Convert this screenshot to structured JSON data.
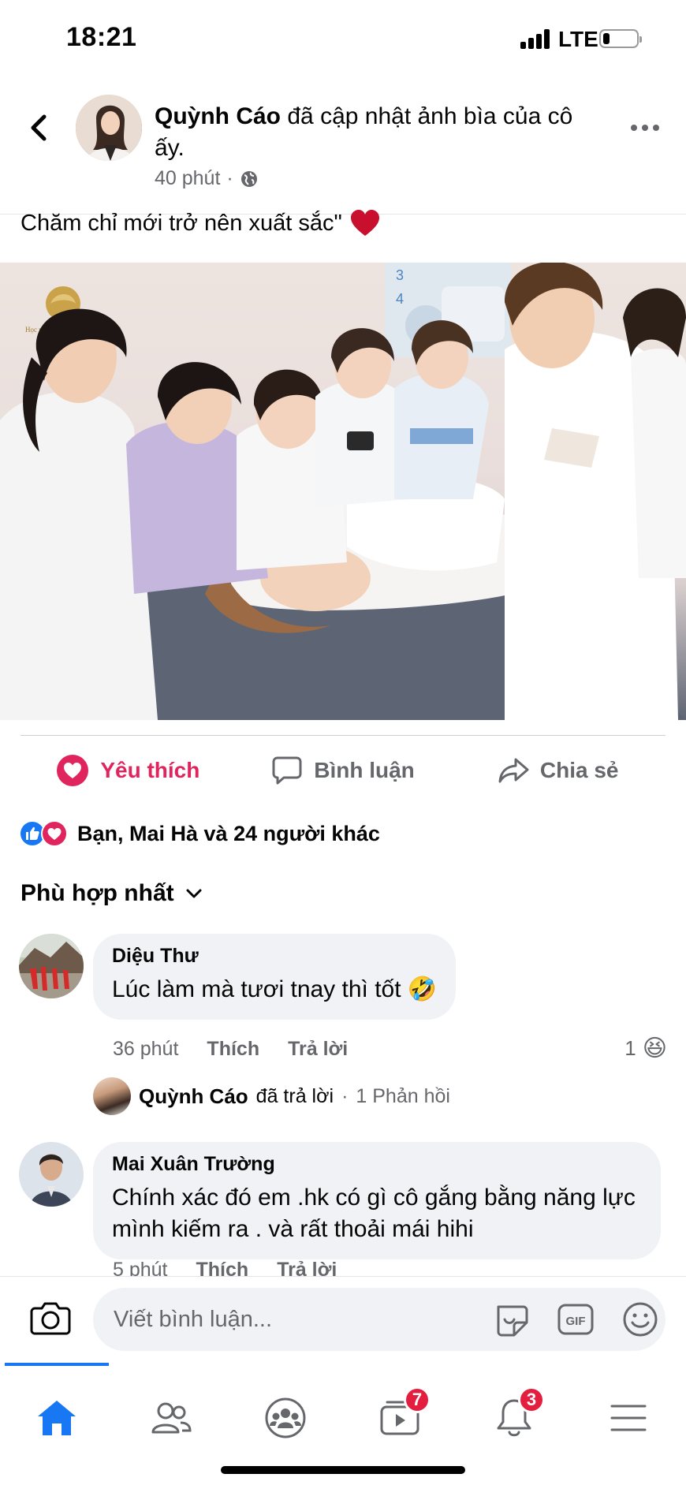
{
  "status_bar": {
    "time": "18:21",
    "network": "LTE",
    "battery_level": 0.2
  },
  "header": {
    "back_icon": "chevron-left-icon",
    "author": "Quỳnh Cáo",
    "action_text": "đã cập nhật ảnh bìa của cô ấy.",
    "time": "40 phút",
    "separator": "·",
    "privacy_icon": "globe-icon",
    "more_icon": "more-horizontal-icon"
  },
  "post": {
    "caption": "Chăm chỉ mới trở nên xuất sắc\"",
    "caption_emoji": "❤️",
    "photo_logo_text": "Học viện thẩm mỹ quốc tế MAYA"
  },
  "actions": {
    "like_label": "Yêu thích",
    "comment_label": "Bình luận",
    "share_label": "Chia sẻ"
  },
  "reactions": {
    "summary": "Bạn, Mai Hà và 24 người khác"
  },
  "sort": {
    "label": "Phù hợp nhất"
  },
  "comments": [
    {
      "name": "Diệu Thư",
      "text": "Lúc làm mà tươi tnay thì tốt 🤣",
      "time": "36 phút",
      "like_label": "Thích",
      "reply_label": "Trả lời",
      "reaction_count": "1",
      "reaction_emoji": "😆"
    },
    {
      "name": "Mai Xuân Trường",
      "text": "Chính xác đó em .hk có gì cô gắng bằng năng lực mình kiếm ra . và rất thoải mái hihi",
      "time": "5 phút",
      "like_label": "Thích",
      "reply_label": "Trả lời"
    }
  ],
  "reply_summary": {
    "name": "Quỳnh Cáo",
    "action": "đã trả lời",
    "separator": "·",
    "count": "1 Phản hồi"
  },
  "composer": {
    "placeholder": "Viết bình luận..."
  },
  "nav": {
    "items": [
      "home-icon",
      "friends-icon",
      "groups-icon",
      "watch-icon",
      "notifications-icon",
      "menu-icon"
    ],
    "watch_badge": "7",
    "notifications_badge": "3"
  },
  "colors": {
    "brand": "#1877f2",
    "love": "#e0245e",
    "badge": "#e41e3f",
    "secondary_text": "#65676b",
    "bubble": "#f0f2f5"
  }
}
